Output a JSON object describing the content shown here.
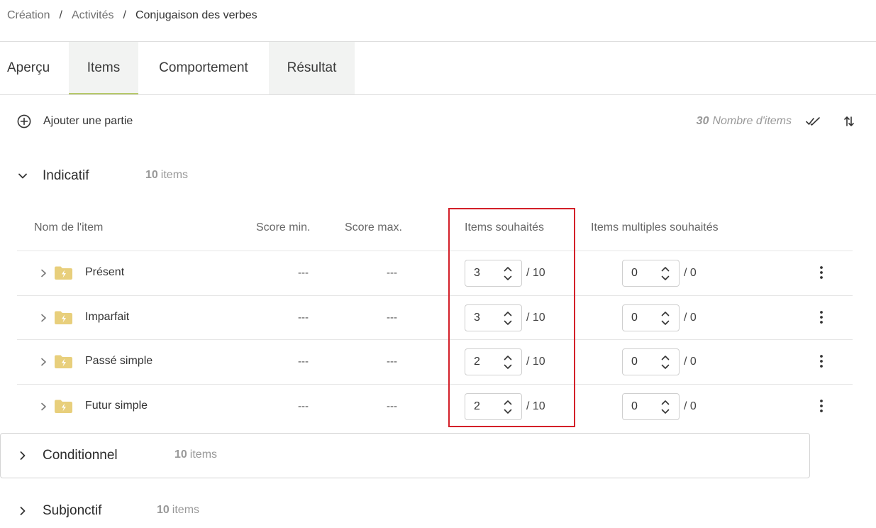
{
  "breadcrumb": {
    "items": [
      "Création",
      "Activités",
      "Conjugaison des verbes"
    ],
    "separator": "/"
  },
  "tabs": [
    "Aperçu",
    "Items",
    "Comportement",
    "Résultat"
  ],
  "active_tab": "Items",
  "toolbar": {
    "add_part_label": "Ajouter une partie",
    "items_total": "30",
    "items_total_label": "Nombre d'items"
  },
  "sections": [
    {
      "title": "Indicatif",
      "count": "10",
      "count_label": "items",
      "expanded": true
    },
    {
      "title": "Conditionnel",
      "count": "10",
      "count_label": "items",
      "expanded": false
    },
    {
      "title": "Subjonctif",
      "count": "10",
      "count_label": "items",
      "expanded": false
    }
  ],
  "table": {
    "headers": {
      "name": "Nom de l'item",
      "score_min": "Score min.",
      "score_max": "Score max.",
      "items_wanted": "Items souhaités",
      "multi_wanted": "Items multiples souhaités"
    },
    "rows": [
      {
        "name": "Présent",
        "score_min": "---",
        "score_max": "---",
        "wanted": "3",
        "wanted_total": "/ 10",
        "multi": "0",
        "multi_total": "/ 0"
      },
      {
        "name": "Imparfait",
        "score_min": "---",
        "score_max": "---",
        "wanted": "3",
        "wanted_total": "/ 10",
        "multi": "0",
        "multi_total": "/ 0"
      },
      {
        "name": "Passé simple",
        "score_min": "---",
        "score_max": "---",
        "wanted": "2",
        "wanted_total": "/ 10",
        "multi": "0",
        "multi_total": "/ 0"
      },
      {
        "name": "Futur simple",
        "score_min": "---",
        "score_max": "---",
        "wanted": "2",
        "wanted_total": "/ 10",
        "multi": "0",
        "multi_total": "/ 0"
      }
    ]
  },
  "colors": {
    "accent": "#b7c96b",
    "highlight": "#d32029",
    "folder": "#e8cf7c",
    "tab_bg": "#f2f3f2"
  },
  "icons": {
    "add": "plus-circle-icon",
    "validate_all": "double-check-icon",
    "sort": "sort-arrows-icon",
    "folder": "folder-lightning-icon",
    "menu": "kebab-icon"
  }
}
